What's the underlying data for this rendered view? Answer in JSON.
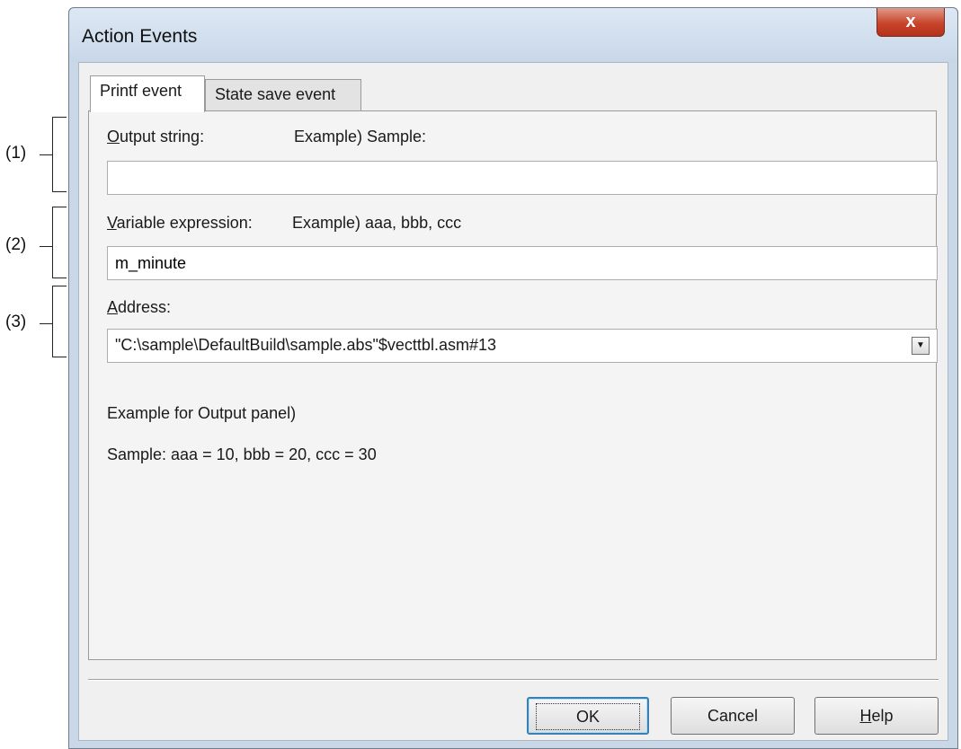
{
  "callouts": [
    "(1)",
    "(2)",
    "(3)"
  ],
  "window": {
    "title": "Action Events",
    "close_glyph": "x"
  },
  "tabs": [
    {
      "label": "Printf event",
      "active": true
    },
    {
      "label": "State save event",
      "active": false
    }
  ],
  "form": {
    "output_string": {
      "label": "Output string:",
      "accesskey": "O",
      "example": "Example) Sample:",
      "value": ""
    },
    "variable_expression": {
      "label": "Variable expression:",
      "accesskey": "V",
      "example": "Example) aaa, bbb, ccc",
      "value": "m_minute"
    },
    "address": {
      "label": "Address:",
      "accesskey": "A",
      "value": "\"C:\\sample\\DefaultBuild\\sample.abs\"$vecttbl.asm#13"
    },
    "output_example_title": "Example for Output panel)",
    "output_example_text": "Sample: aaa = 10, bbb = 20, ccc = 30"
  },
  "buttons": {
    "ok": "OK",
    "cancel": "Cancel",
    "help": "Help"
  },
  "icons": {
    "dropdown": "chevron-down-icon",
    "close": "close-icon"
  }
}
